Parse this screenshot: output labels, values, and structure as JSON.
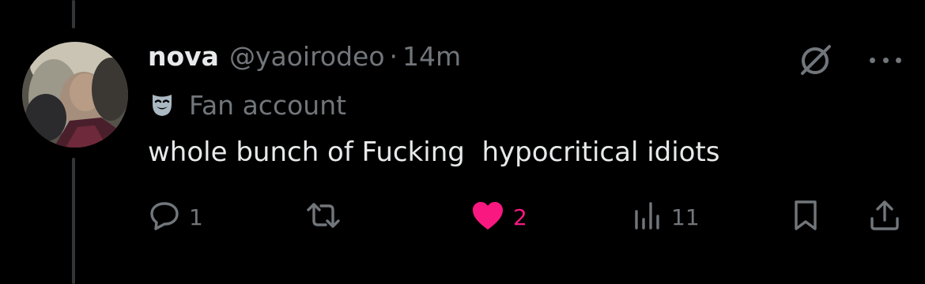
{
  "tweet": {
    "display_name": "nova",
    "handle": "@yaoirodeo",
    "separator": "·",
    "time": "14m",
    "label": "Fan account",
    "text": "whole bunch of Fucking  hypocritical idiots"
  },
  "actions": {
    "replies": "1",
    "reposts": "",
    "likes": "2",
    "views": "11"
  },
  "icons": {
    "label_icon": "theater-mask-icon",
    "grok": "grok-icon",
    "more": "more-icon",
    "reply": "reply-icon",
    "repost": "repost-icon",
    "like": "heart-icon",
    "views": "views-icon",
    "bookmark": "bookmark-icon",
    "share": "share-icon"
  },
  "colors": {
    "background": "#000000",
    "text_primary": "#e7e9ea",
    "text_secondary": "#71767b",
    "like_active": "#f91880",
    "thread_line": "#333639"
  }
}
